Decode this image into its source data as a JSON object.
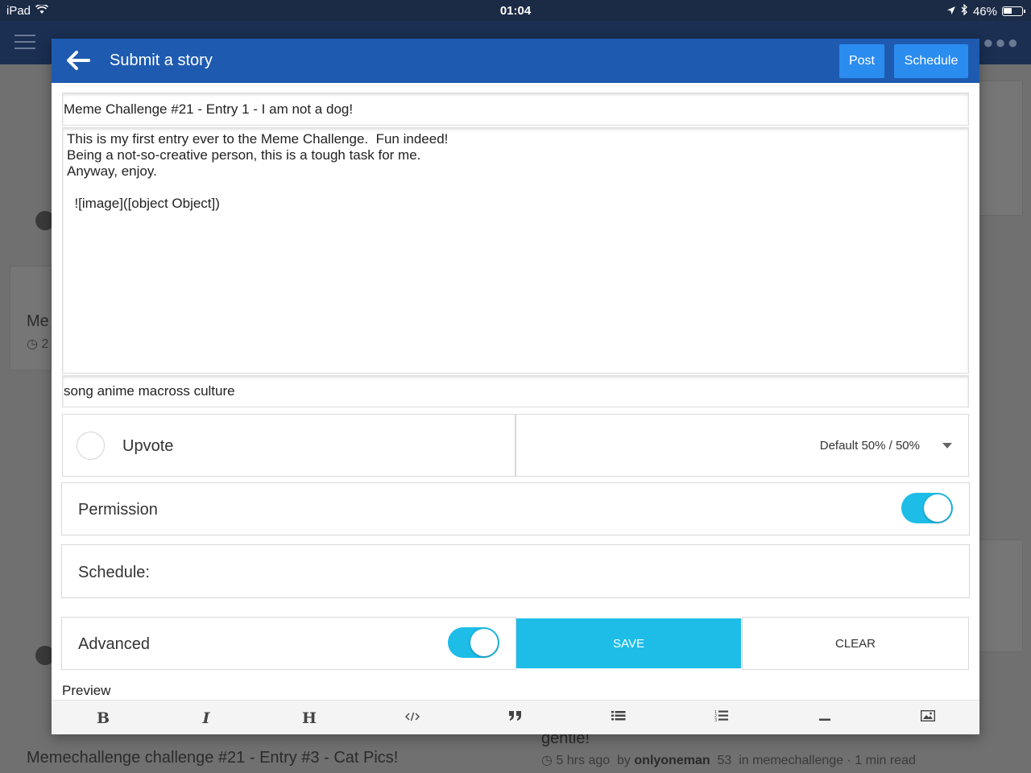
{
  "status_bar": {
    "device": "iPad",
    "time": "01:04",
    "battery": "46%",
    "battery_level": 0.46
  },
  "background": {
    "left_title_fragment": "Me",
    "left_meta_fragment": "2",
    "bottom_left_title": "Memechallenge challenge #21 - Entry #3 - Cat Pics!",
    "bottom_right_title_fragment": "gentle!",
    "bottom_right_meta": {
      "age": "5 hrs ago",
      "by": "by",
      "author": "onlyoneman",
      "reputation": "53",
      "in": "in memechallenge · 1 min read"
    }
  },
  "modal": {
    "title": "Submit a story",
    "post_label": "Post",
    "schedule_label": "Schedule",
    "story_title": "Meme Challenge #21 - Entry 1 - I am not a dog!",
    "story_body": "This is my first entry ever to the Meme Challenge.  Fun indeed!\nBeing a not-so-creative person, this is a tough task for me.\nAnyway, enjoy.\n\n  ![image]([object Object])",
    "tags": "song anime macross culture",
    "upvote": {
      "label": "Upvote",
      "checked": false
    },
    "reward": {
      "selected": "Default 50% / 50%"
    },
    "permission": {
      "label": "Permission",
      "enabled": true
    },
    "schedule_field": {
      "label": "Schedule:"
    },
    "advanced": {
      "label": "Advanced",
      "enabled": true
    },
    "save_label": "SAVE",
    "clear_label": "CLEAR",
    "preview_label": "Preview",
    "toolbar": {
      "bold": "B",
      "italic": "I",
      "heading": "H",
      "code_icon": "code-icon",
      "quote_icon": "quote-icon",
      "bulleted_list_icon": "bulleted-list-icon",
      "numbered_list_icon": "numbered-list-icon",
      "horizontal_rule_icon": "horizontal-rule-icon",
      "image_icon": "image-icon"
    }
  },
  "colors": {
    "header_blue": "#1e5bb0",
    "button_blue": "#2b8cf0",
    "accent_cyan": "#1dbde8"
  }
}
